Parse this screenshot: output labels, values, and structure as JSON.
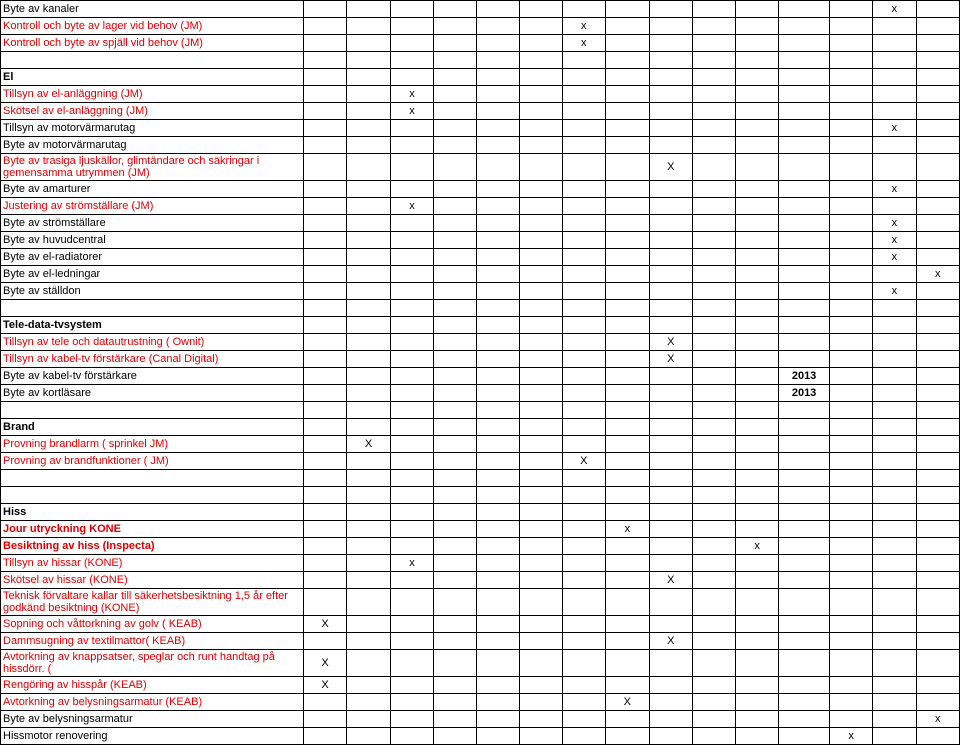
{
  "rows": [
    {
      "label": "Byte av kanaler",
      "red": false,
      "bold": false,
      "mark": 14
    },
    {
      "label": "Kontroll och byte av lager vid behov (JM)",
      "red": true,
      "bold": false,
      "mark": 7
    },
    {
      "label": "Kontroll och byte av spjäll vid behov (JM)",
      "red": true,
      "bold": false,
      "mark": 7
    },
    {
      "label": "",
      "red": false,
      "bold": false,
      "mark": null
    },
    {
      "label": "El",
      "red": false,
      "bold": true,
      "mark": null
    },
    {
      "label": "Tillsyn av el-anläggning (JM)",
      "red": true,
      "bold": false,
      "mark": 3
    },
    {
      "label": "Skötsel av el-anläggning (JM)",
      "red": true,
      "bold": false,
      "mark": 3
    },
    {
      "label": "Tillsyn av motorvärmarutag",
      "red": false,
      "bold": false,
      "mark": 14
    },
    {
      "label": "Byte av motorvärmarutag",
      "red": false,
      "bold": false,
      "mark": null
    },
    {
      "label": "Byte av trasiga ljuskällor, glimtändare och säkringar i gemensamma utrymmen (JM)",
      "red": true,
      "bold": false,
      "mark": 9,
      "markText": "X"
    },
    {
      "label": "Byte av amarturer",
      "red": false,
      "bold": false,
      "mark": 14
    },
    {
      "label": "Justering av strömställare (JM)",
      "red": true,
      "bold": false,
      "mark": 3
    },
    {
      "label": "Byte av strömställare",
      "red": false,
      "bold": false,
      "mark": 14
    },
    {
      "label": "Byte av huvudcentral",
      "red": false,
      "bold": false,
      "mark": 14
    },
    {
      "label": "Byte av el-radiatorer",
      "red": false,
      "bold": false,
      "mark": 14
    },
    {
      "label": "Byte av el-ledningar",
      "red": false,
      "bold": false,
      "mark": 15
    },
    {
      "label": "Byte av ställdon",
      "red": false,
      "bold": false,
      "mark": 14
    },
    {
      "label": "",
      "red": false,
      "bold": false,
      "mark": null
    },
    {
      "label": "Tele-data-tvsystem",
      "red": false,
      "bold": true,
      "mark": null
    },
    {
      "label": "Tillsyn av tele och datautrustning ( Ownit)",
      "red": true,
      "bold": false,
      "mark": 9,
      "markText": "X"
    },
    {
      "label": "Tillsyn av kabel-tv förstärkare (Canal Digital)",
      "red": true,
      "bold": false,
      "mark": 9,
      "markText": "X"
    },
    {
      "label": "Byte av kabel-tv förstärkare",
      "red": false,
      "bold": false,
      "mark": 12,
      "markText": "2013",
      "markBold": true
    },
    {
      "label": "Byte av kortläsare",
      "red": false,
      "bold": false,
      "mark": 12,
      "markText": "2013",
      "markBold": true
    },
    {
      "label": "",
      "red": false,
      "bold": false,
      "mark": null
    },
    {
      "label": "Brand",
      "red": false,
      "bold": true,
      "mark": null
    },
    {
      "label": "Provning brandlarm ( sprinkel  JM)",
      "red": true,
      "bold": false,
      "mark": 2,
      "markText": "X"
    },
    {
      "label": "Provning av brandfunktioner ( JM)",
      "red": true,
      "bold": false,
      "mark": 7,
      "markText": "X"
    },
    {
      "label": "",
      "red": false,
      "bold": false,
      "mark": null
    },
    {
      "label": "",
      "red": false,
      "bold": false,
      "mark": null
    },
    {
      "label": "Hiss",
      "red": false,
      "bold": true,
      "mark": null
    },
    {
      "label": "Jour utryckning KONE",
      "red": true,
      "bold": true,
      "mark": 8
    },
    {
      "label": "Besiktning av hiss (Inspecta)",
      "red": true,
      "bold": true,
      "mark": 11
    },
    {
      "label": "Tillsyn av hissar (KONE)",
      "red": true,
      "bold": false,
      "mark": 3
    },
    {
      "label": "Skötsel av hissar (KONE)",
      "red": true,
      "bold": false,
      "mark": 9,
      "markText": "X"
    },
    {
      "label": "Teknisk förvaltare kallar till säkerhetsbesiktning 1,5 år efter godkänd besiktning (KONE)",
      "red": true,
      "bold": false,
      "mark": null
    },
    {
      "label": "Sopning och våttorkning av golv ( KEAB)",
      "red": true,
      "bold": false,
      "mark": 1,
      "markText": "X"
    },
    {
      "label": "Dammsugning av textilmattor( KEAB)",
      "red": true,
      "bold": false,
      "mark": 9,
      "markText": "X"
    },
    {
      "label": "Avtorkning av knappsatser, speglar och runt handtag på hissdörr. (",
      "red": true,
      "bold": false,
      "mark": 1,
      "markText": "X"
    },
    {
      "label": "Rengöring av hisspår (KEAB)",
      "red": true,
      "bold": false,
      "mark": 1,
      "markText": "X"
    },
    {
      "label": "Avtorkning av belysningsarmatur (KEAB)",
      "red": true,
      "bold": false,
      "mark": 8,
      "markText": "X"
    },
    {
      "label": "Byte av belysningsarmatur",
      "red": false,
      "bold": false,
      "mark": 15
    },
    {
      "label": "Hissmotor renovering",
      "red": false,
      "bold": false,
      "mark": 13
    }
  ],
  "defaultMark": "x",
  "numCols": 15
}
